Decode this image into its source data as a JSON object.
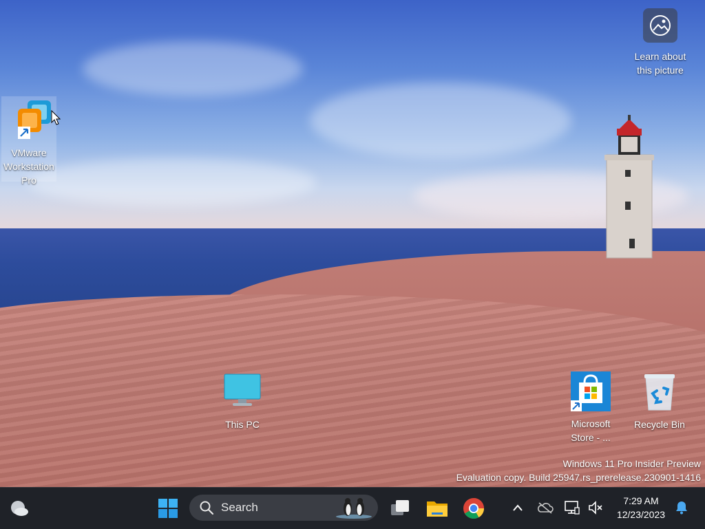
{
  "desktop": {
    "icons": [
      {
        "label": "VMware Workstation Pro"
      },
      {
        "label": "This PC"
      },
      {
        "label": "Microsoft Store - ..."
      },
      {
        "label": "Recycle Bin"
      }
    ],
    "learn_about": {
      "label": "Learn about this picture"
    },
    "watermark": {
      "line1": "Windows 11 Pro Insider Preview",
      "line2": "Evaluation copy. Build 25947.rs_prerelease.230901-1416"
    }
  },
  "taskbar": {
    "search": {
      "placeholder": "Search"
    },
    "clock": {
      "time": "7:29 AM",
      "date": "12/23/2023"
    },
    "colors": {
      "background": "#1f2228",
      "accent": "#0078d4"
    }
  }
}
